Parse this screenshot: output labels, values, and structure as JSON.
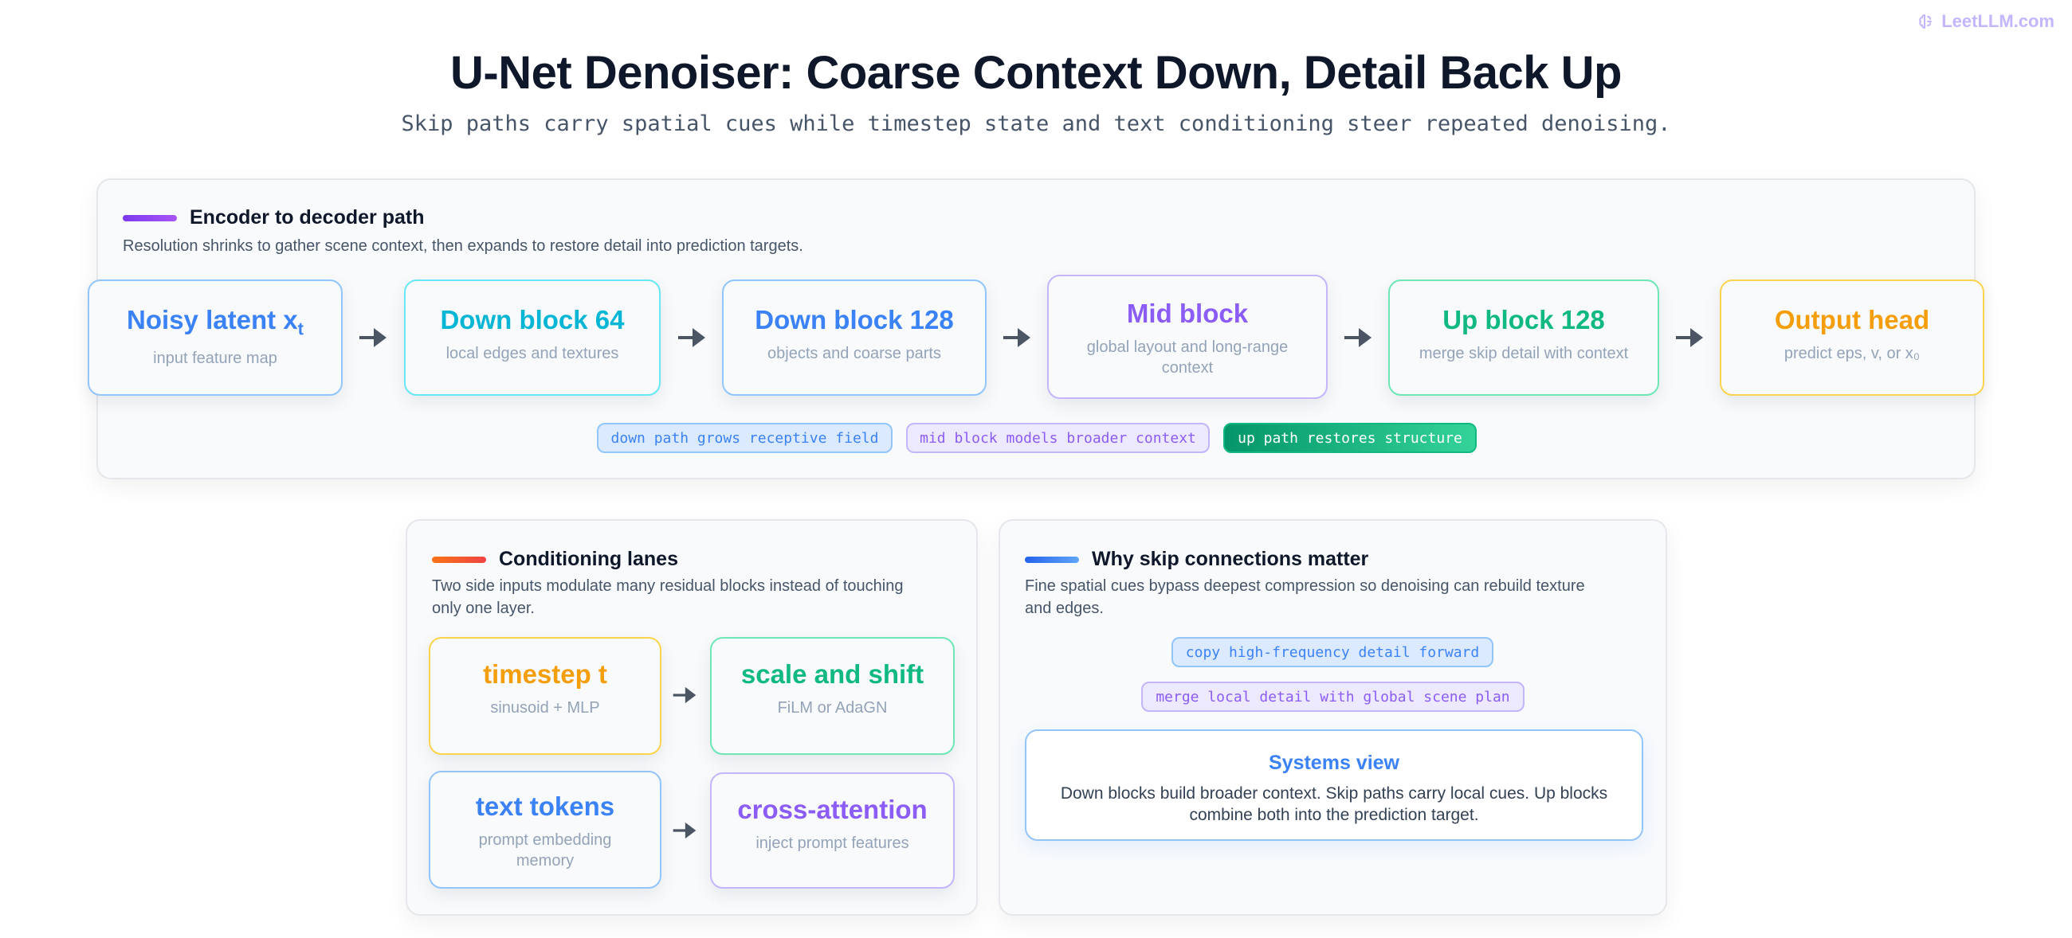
{
  "brand": {
    "label": "LeetLLM.com",
    "icon": "brain-icon",
    "color": "#c4b5fd"
  },
  "title": "U-Net Denoiser: Coarse Context Down, Detail Back Up",
  "subtitle": "Skip paths carry spatial cues while timestep state and text conditioning steer repeated denoising.",
  "encoder_panel": {
    "title": "Encoder to decoder path",
    "description": "Resolution shrinks to gather scene context, then expands to restore detail into prediction targets.",
    "accent": "#9333ea",
    "nodes": [
      {
        "title": "Noisy latent x",
        "title_sub": "t",
        "subtitle": "input feature map",
        "color": "#3b82f6"
      },
      {
        "title": "Down block 64",
        "subtitle": "local edges and textures",
        "color": "#06b6d4"
      },
      {
        "title": "Down block 128",
        "subtitle": "objects and coarse parts",
        "color": "#3b82f6"
      },
      {
        "title": "Mid block",
        "subtitle_lines": [
          "global layout and long-range",
          "context"
        ],
        "color": "#8b5cf6"
      },
      {
        "title": "Up block 128",
        "subtitle": "merge skip detail with context",
        "color": "#10b981"
      },
      {
        "title": "Output head",
        "subtitle": "predict eps, v, or x₀",
        "color": "#f59e0b"
      }
    ],
    "chips": [
      {
        "label": "down path grows receptive field"
      },
      {
        "label": "mid block models broader context"
      },
      {
        "label": "up path restores structure"
      }
    ]
  },
  "conditioning_panel": {
    "title": "Conditioning lanes",
    "description_lines": [
      "Two side inputs modulate many residual blocks instead of touching",
      "only one layer."
    ],
    "accent": "#f97316",
    "nodes": [
      {
        "title": "timestep t",
        "subtitle": "sinusoid + MLP",
        "color": "#f59e0b"
      },
      {
        "title": "scale and shift",
        "subtitle": "FiLM or AdaGN",
        "color": "#10b981"
      },
      {
        "title": "text tokens",
        "subtitle_lines": [
          "prompt embedding",
          "memory"
        ],
        "color": "#3b82f6"
      },
      {
        "title": "cross-attention",
        "subtitle": "inject prompt features",
        "color": "#8b5cf6"
      }
    ]
  },
  "skip_panel": {
    "title": "Why skip connections matter",
    "description_lines": [
      "Fine spatial cues bypass deepest compression so denoising can rebuild texture",
      "and edges."
    ],
    "accent": "#3b82f6",
    "chips": [
      {
        "label": "copy high-frequency detail forward"
      },
      {
        "label": "merge local detail with global scene plan"
      }
    ],
    "systems_view": {
      "title": "Systems view",
      "text_lines": [
        "Down blocks build broader context. Skip paths carry local cues. Up blocks",
        "combine both into the prediction target."
      ]
    }
  }
}
